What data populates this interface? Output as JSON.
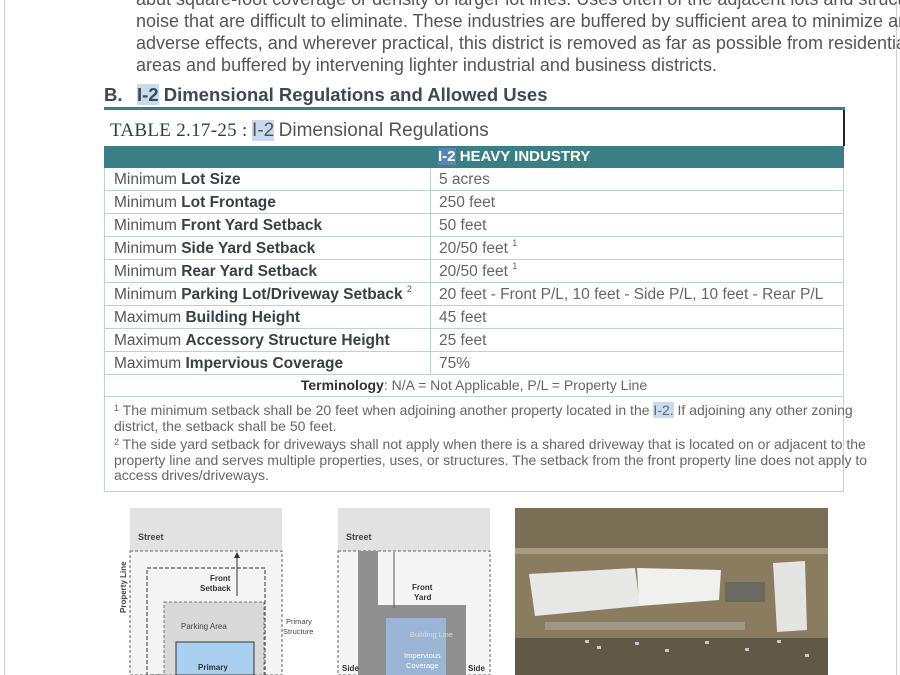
{
  "intro": {
    "line1": "abut square-foot coverage or density of larger lot lines. Uses often of the adjacent lots and structures",
    "line2": "noise that are difficult to eliminate. These industries are buffered by sufficient area to minimize any",
    "line3": "adverse effects, and wherever practical, this district is removed as far as possible from residential",
    "line4": "areas and buffered by intervening lighter industrial and business districts."
  },
  "section": {
    "letter": "B.",
    "code": "I-2",
    "title": "Dimensional Regulations and Allowed Uses"
  },
  "table": {
    "number": "TABLE 2.17-25 :",
    "code": "I-2",
    "title": "Dimensional Regulations",
    "header_code": "I-2",
    "header_title": "HEAVY INDUSTRY",
    "rows": [
      {
        "prefix": "Minimum",
        "label": "Lot Size",
        "sup": "",
        "value": "5 acres",
        "value_sup": ""
      },
      {
        "prefix": "Minimum",
        "label": "Lot Frontage",
        "sup": "",
        "value": "250 feet",
        "value_sup": ""
      },
      {
        "prefix": "Minimum",
        "label": "Front Yard Setback",
        "sup": "",
        "value": "50 feet",
        "value_sup": ""
      },
      {
        "prefix": "Minimum",
        "label": "Side Yard Setback",
        "sup": "",
        "value": "20/50 feet",
        "value_sup": "1"
      },
      {
        "prefix": "Minimum",
        "label": "Rear Yard Setback",
        "sup": "",
        "value": "20/50 feet",
        "value_sup": "1"
      },
      {
        "prefix": "Minimum",
        "label": "Parking Lot/Driveway Setback",
        "sup": "2",
        "value": "20 feet - Front P/L, 10 feet - Side P/L, 10 feet - Rear P/L",
        "value_sup": ""
      },
      {
        "prefix": "Maximum",
        "label": "Building Height",
        "sup": "",
        "value": "45 feet",
        "value_sup": ""
      },
      {
        "prefix": "Maximum",
        "label": "Accessory Structure Height",
        "sup": "",
        "value": "25 feet",
        "value_sup": ""
      },
      {
        "prefix": "Maximum",
        "label": "Impervious Coverage",
        "sup": "",
        "value": "75%",
        "value_sup": ""
      }
    ],
    "terminology_label": "Terminology",
    "terminology_text": ": N/A = Not Applicable, P/L = Property Line",
    "footnote1": {
      "marker": "1",
      "text_a": "The minimum setback shall be 20 feet when adjoining another property located in the ",
      "code": "I-2.",
      "text_b": " If adjoining any other zoning",
      "text_c": "district, the setback shall be 50 feet."
    },
    "footnote2": {
      "marker": "2",
      "line1": "The side yard setback for driveways shall not apply when there is a shared driveway that is located on or adjacent to the",
      "line2": "property line and serves multiple properties, uses, or structures. The setback from the front property line does not apply to",
      "line3": "access drives/driveways."
    }
  },
  "figures": {
    "fig1": {
      "street": "Street",
      "property_line": "Property Line",
      "front_setback_1": "Front",
      "front_setback_2": "Setback",
      "parking_area": "Parking Area",
      "primary": "Primary",
      "primary_structure_1": "Primary",
      "primary_structure_2": "Structure"
    },
    "fig2": {
      "street": "Street",
      "front_yard_1": "Front",
      "front_yard_2": "Yard",
      "building_line": "Building Line",
      "impervious_1": "Impervious",
      "impervious_2": "Coverage",
      "side_left": "Side",
      "side_right": "Side"
    }
  }
}
